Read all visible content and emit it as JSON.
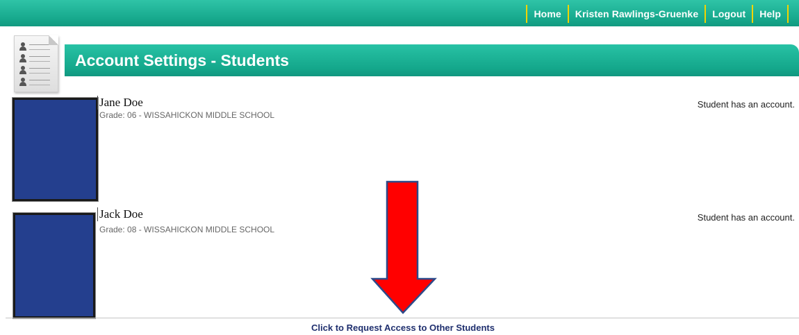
{
  "nav": {
    "links": [
      "Home",
      "Kristen Rawlings-Gruenke",
      "Logout",
      "Help"
    ],
    "separator_color": "#f2d400"
  },
  "header": {
    "icon": "student-list-icon",
    "title": "Account Settings - Students"
  },
  "students": [
    {
      "name": "Jane Doe",
      "grade": "Grade: 06 - WISSAHICKON MIDDLE SCHOOL",
      "status": "Student has an account."
    },
    {
      "name": "Jack Doe",
      "grade": "Grade: 08 - WISSAHICKON MIDDLE SCHOOL",
      "status": "Student has an account."
    }
  ],
  "footer": {
    "request_link": "Click to Request Access to Other Students"
  },
  "colors": {
    "brand_teal": "#17a98d",
    "photo_redaction": "#243f8e",
    "arrow_red": "#ff0000",
    "link_navy": "#1f2f6e"
  }
}
